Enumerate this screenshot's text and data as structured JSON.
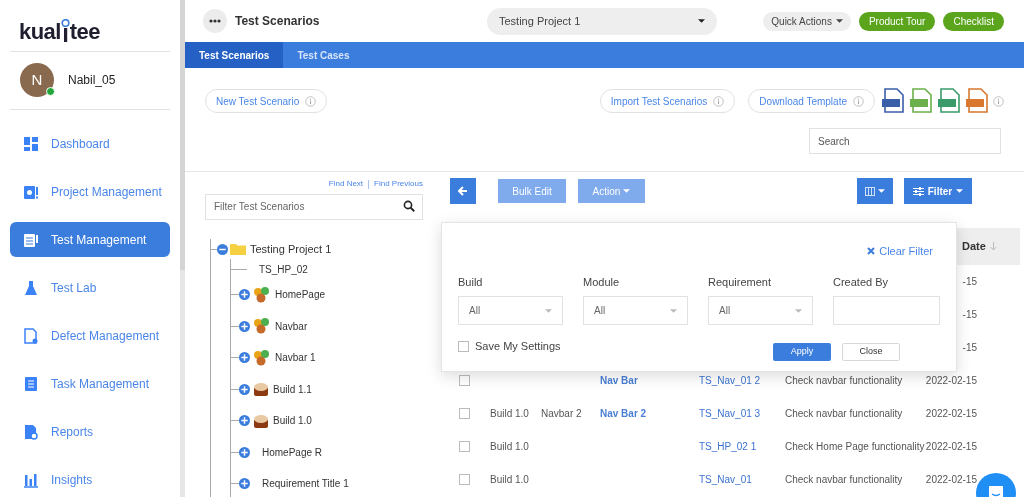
{
  "sidebar": {
    "logo_before": "kual",
    "logo_after": "tee",
    "user": {
      "initial": "N",
      "name": "Nabil_05",
      "online": true
    },
    "nav": [
      {
        "label": "Dashboard",
        "kind": "dashboard",
        "selected": false
      },
      {
        "label": "Project Management",
        "kind": "project",
        "selected": false
      },
      {
        "label": "Test Management",
        "kind": "test",
        "selected": true
      },
      {
        "label": "Test Lab",
        "kind": "lab",
        "selected": false
      },
      {
        "label": "Defect Management",
        "kind": "defect",
        "selected": false
      },
      {
        "label": "Task Management",
        "kind": "task",
        "selected": false
      },
      {
        "label": "Reports",
        "kind": "reports",
        "selected": false
      },
      {
        "label": "Insights",
        "kind": "insights",
        "selected": false
      }
    ]
  },
  "topbar": {
    "title": "Test Scenarios",
    "project": "Testing Project 1",
    "quick_actions": "Quick Actions",
    "buttons": [
      "Product Tour",
      "Checklist"
    ]
  },
  "tabs": [
    {
      "label": "Test Scenarios",
      "selected": true
    },
    {
      "label": "Test Cases",
      "selected": false
    }
  ],
  "actions": {
    "new": "New Test Scenario",
    "import": "Import Test Scenarios",
    "download": "Download Template",
    "templates": [
      {
        "color": "#3b5ea8"
      },
      {
        "color": "#6bb04a"
      },
      {
        "color": "#3a9a6a"
      },
      {
        "color": "#d9782e"
      }
    ],
    "search_placeholder": "Search"
  },
  "tree": {
    "find_next": "Find Next",
    "find_previous": "Find Previous",
    "filter_placeholder": "Filter Test Scenarios",
    "root": {
      "label": "Testing Project 1",
      "expanded": true,
      "children": [
        {
          "label": "TS_HP_02",
          "kind": "scenario"
        },
        {
          "label": "HomePage",
          "kind": "module",
          "expanded": false
        },
        {
          "label": "Navbar",
          "kind": "module",
          "expanded": false
        },
        {
          "label": "Navbar 1",
          "kind": "module",
          "expanded": false
        },
        {
          "label": "Build 1.1",
          "kind": "build",
          "expanded": false
        },
        {
          "label": "Build 1.0",
          "kind": "build",
          "expanded": false
        },
        {
          "label": "HomePage R",
          "kind": "requirement",
          "expanded": false
        },
        {
          "label": "Requirement Title 1",
          "kind": "requirement",
          "expanded": false
        }
      ]
    }
  },
  "toolbar": {
    "bulk_edit": "Bulk Edit",
    "action": "Action",
    "filter": "Filter"
  },
  "filter_popup": {
    "clear": "Clear Filter",
    "fields": [
      {
        "label": "Build",
        "kind": "select",
        "value": "All"
      },
      {
        "label": "Module",
        "kind": "select",
        "value": "All"
      },
      {
        "label": "Requirement",
        "kind": "select",
        "value": "All"
      },
      {
        "label": "Created By",
        "kind": "text"
      }
    ],
    "save_settings": {
      "label": "Save My Settings",
      "checked": false
    },
    "apply": "Apply",
    "close": "Close"
  },
  "table": {
    "date_header": "Date",
    "rows": [
      {
        "date": "-15"
      },
      {
        "date": "-15"
      },
      {
        "date": "-15"
      },
      {
        "checked": false,
        "requirement": "Nav Bar",
        "id": "TS_Nav_01 2",
        "description": "Check navbar functionality",
        "date": "2022-02-15"
      },
      {
        "checked": false,
        "build": "Build 1.0",
        "module": "Navbar 2",
        "requirement": "Nav Bar 2",
        "id": "TS_Nav_01 3",
        "description": "Check navbar functionality",
        "date": "2022-02-15"
      },
      {
        "checked": false,
        "build": "Build 1.0",
        "id": "TS_HP_02 1",
        "description": "Check Home Page functionality",
        "date": "2022-02-15"
      },
      {
        "checked": false,
        "build": "Build 1.0",
        "id": "TS_Nav_01",
        "description": "Check navbar functionality",
        "date": "2022-02-15"
      }
    ]
  }
}
